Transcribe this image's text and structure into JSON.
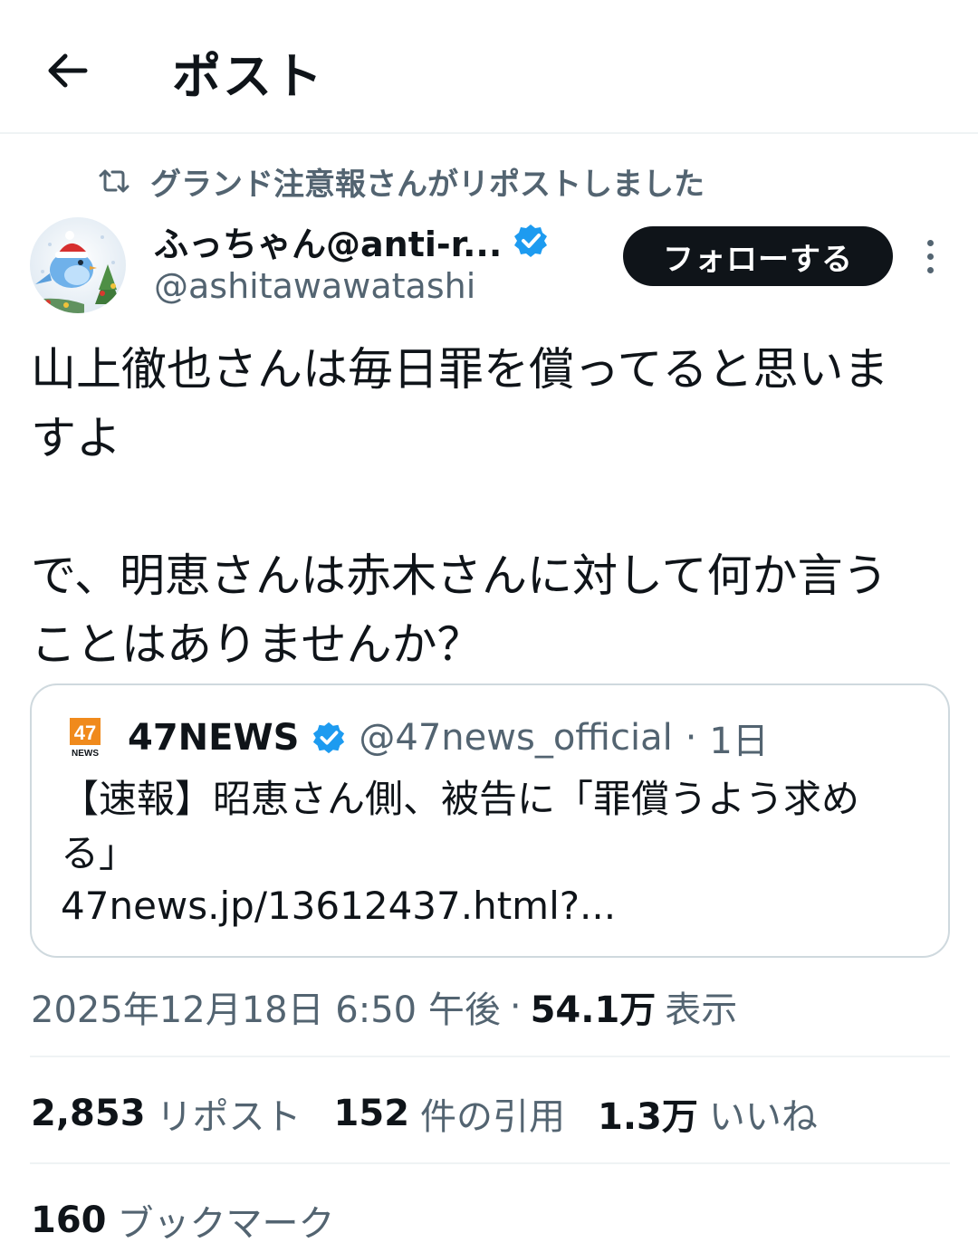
{
  "header": {
    "title": "ポスト"
  },
  "repost_context": {
    "text": "グランド注意報さんがリポストしました"
  },
  "author": {
    "display_name": "ふっちゃん@anti-r...",
    "handle": "@ashitawawatashi",
    "verified": true,
    "follow_label": "フォローする"
  },
  "post": {
    "text": "山上徹也さんは毎日罪を償ってると思いま\nすよ\n\nで、明恵さんは赤木さんに対して何か言う\nことはありませんか？"
  },
  "quote": {
    "logo_text": "47",
    "logo_sub": "NEWS",
    "name": "47NEWS",
    "handle": "@47news_official",
    "separator": "·",
    "time": "1日",
    "text": "【速報】昭恵さん側、被告に「罪償うよう求め\nる」",
    "link": "47news.jp/13612437.html?..."
  },
  "meta": {
    "timestamp": "2025年12月18日 6:50 午後",
    "separator": "·",
    "views_count": "54.1万",
    "views_label": "表示"
  },
  "stats": {
    "reposts_count": "2,853",
    "reposts_label": "リポスト",
    "quotes_count": "152",
    "quotes_label": "件の引用",
    "likes_count": "1.3万",
    "likes_label": "いいね",
    "bookmarks_count": "160",
    "bookmarks_label": "ブックマーク"
  },
  "colors": {
    "text": "#0f1419",
    "secondary": "#536471",
    "verified": "#1d9bf0",
    "border": "#cfd9de",
    "divider": "#eff3f4",
    "news_logo": "#f08a1c"
  }
}
